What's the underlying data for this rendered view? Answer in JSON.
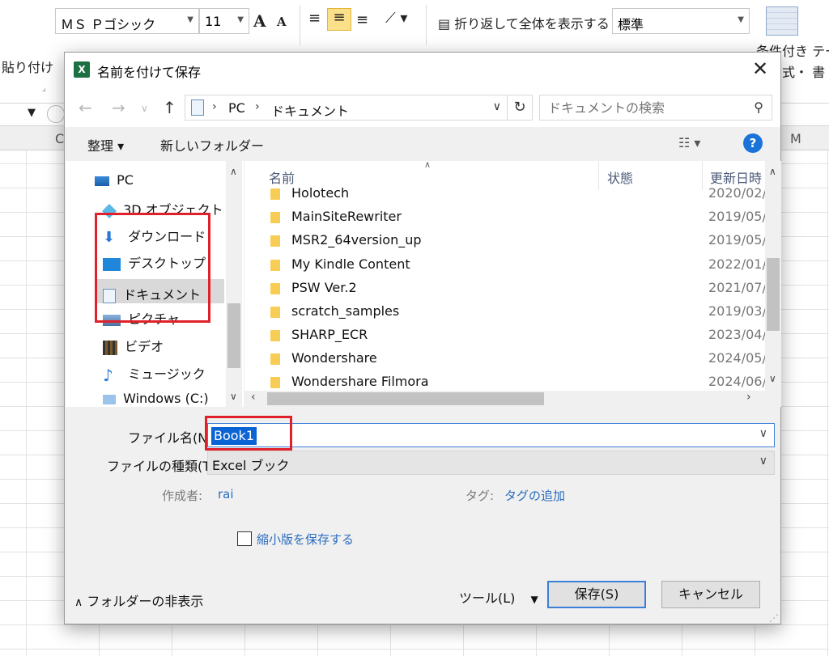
{
  "excel": {
    "font_name": "ＭＳ Ｐゴシック",
    "font_size": "11",
    "grow_font": "A",
    "shrink_font": "A",
    "wrap_text": "折り返して全体を表示する",
    "number_format": "標準",
    "paste": "貼り付け",
    "conditional_format": "条件付き テー",
    "format_fragment": "式・ 書",
    "col_c": "C",
    "col_m": "M"
  },
  "dialog": {
    "title": "名前を付けて保存",
    "close": "✕",
    "breadcrumb": [
      "PC",
      "ドキュメント"
    ],
    "search_placeholder": "ドキュメントの検索",
    "toolbar": {
      "organize": "整理 ▾",
      "new_folder": "新しいフォルダー",
      "help": "?"
    },
    "tree": [
      {
        "label": "PC",
        "icon": "pc-icon"
      },
      {
        "label": "3D オブジェクト",
        "icon": "cube-icon"
      },
      {
        "label": "ダウンロード",
        "icon": "download-icon"
      },
      {
        "label": "デスクトップ",
        "icon": "desktop-icon"
      },
      {
        "label": "ドキュメント",
        "icon": "document-icon",
        "selected": true
      },
      {
        "label": "ピクチャ",
        "icon": "picture-icon"
      },
      {
        "label": "ビデオ",
        "icon": "video-icon"
      },
      {
        "label": "ミュージック",
        "icon": "music-icon"
      },
      {
        "label": "Windows (C:)",
        "icon": "drive-icon"
      }
    ],
    "columns": {
      "name": "名前",
      "status": "状態",
      "modified": "更新日時"
    },
    "files": [
      {
        "name": "Holotech",
        "date": "2020/02/"
      },
      {
        "name": "MainSiteRewriter",
        "date": "2019/05/"
      },
      {
        "name": "MSR2_64version_up",
        "date": "2019/05/"
      },
      {
        "name": "My Kindle Content",
        "date": "2022/01/"
      },
      {
        "name": "PSW Ver.2",
        "date": "2021/07/"
      },
      {
        "name": "scratch_samples",
        "date": "2019/03/"
      },
      {
        "name": "SHARP_ECR",
        "date": "2023/04/"
      },
      {
        "name": "Wondershare",
        "date": "2024/05/"
      },
      {
        "name": "Wondershare Filmora",
        "date": "2024/06/"
      }
    ],
    "form": {
      "filename_label": "ファイル名(N):",
      "filename_value": "Book1",
      "filetype_label": "ファイルの種類(T):",
      "filetype_value": "Excel ブック",
      "author_label": "作成者:",
      "author_value": "rai",
      "tags_label": "タグ:",
      "tags_value": "タグの追加",
      "thumbnail_label": "縮小版を保存する"
    },
    "footer": {
      "hide_folders": "フォルダーの非表示",
      "tools": "ツール(L)",
      "save": "保存(S)",
      "cancel": "キャンセル"
    }
  },
  "colors": {
    "annotation_red": "#e0202a",
    "selection_blue": "#0a64d4",
    "link_blue": "#2b6dbf"
  }
}
